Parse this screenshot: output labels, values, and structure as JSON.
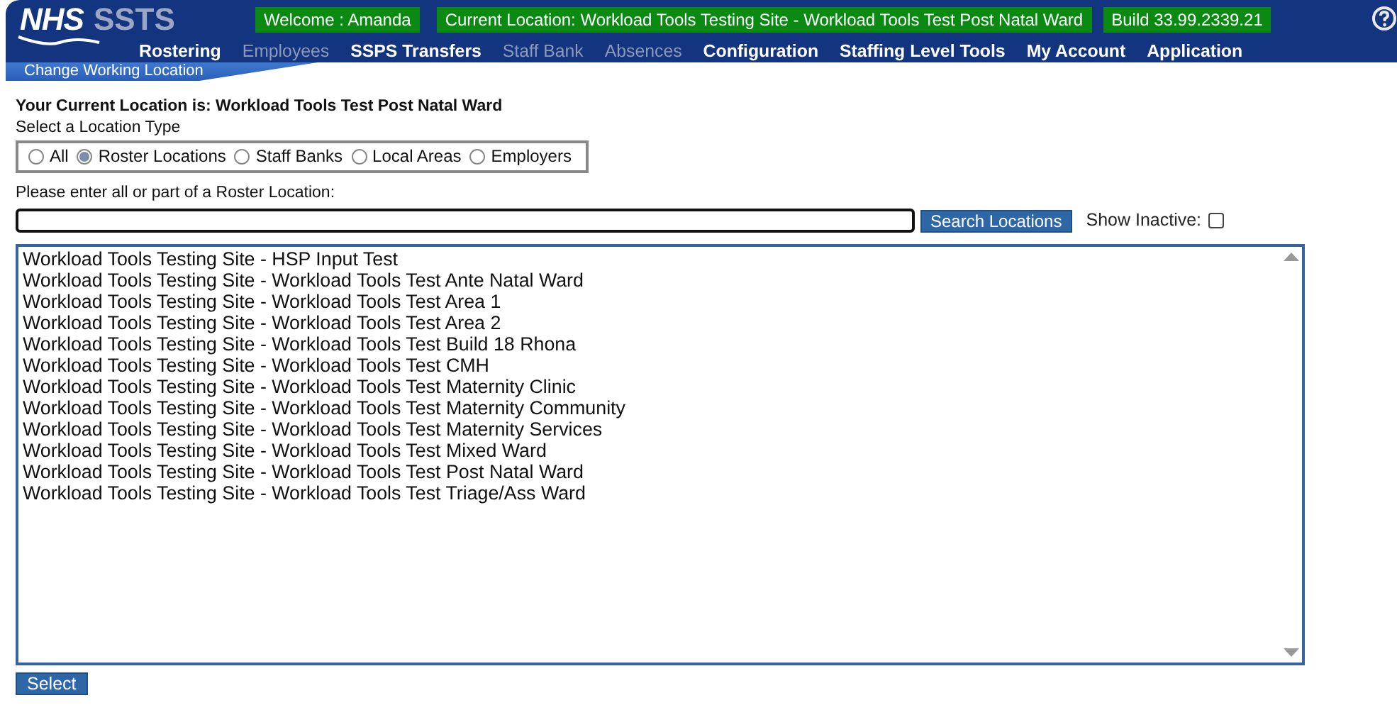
{
  "header": {
    "logo_primary": "NHS",
    "logo_secondary": "SSTS",
    "welcome": "Welcome : Amanda",
    "current_location": "Current Location: Workload Tools Testing Site - Workload Tools Test Post Natal Ward",
    "build": "Build 33.99.2339.21"
  },
  "menu": [
    {
      "label": "Rostering",
      "disabled": false
    },
    {
      "label": "Employees",
      "disabled": true
    },
    {
      "label": "SSPS Transfers",
      "disabled": false
    },
    {
      "label": "Staff Bank",
      "disabled": true
    },
    {
      "label": "Absences",
      "disabled": true
    },
    {
      "label": "Configuration",
      "disabled": false
    },
    {
      "label": "Staffing Level Tools",
      "disabled": false
    },
    {
      "label": "My Account",
      "disabled": false
    },
    {
      "label": "Application",
      "disabled": false
    }
  ],
  "breadcrumb": "Change Working Location",
  "current_location_heading": "Your Current Location is: Workload Tools Test Post Natal Ward",
  "location_type": {
    "label": "Select a Location Type",
    "options": [
      {
        "label": "All",
        "selected": false
      },
      {
        "label": "Roster Locations",
        "selected": true
      },
      {
        "label": "Staff Banks",
        "selected": false
      },
      {
        "label": "Local Areas",
        "selected": false
      },
      {
        "label": "Employers",
        "selected": false
      }
    ]
  },
  "search": {
    "label": "Please enter all or part of a Roster Location:",
    "button": "Search Locations",
    "show_inactive_label": "Show Inactive:",
    "show_inactive": false
  },
  "locations": [
    "Workload Tools Testing Site - HSP Input Test",
    "Workload Tools Testing Site - Workload Tools Test Ante Natal Ward",
    "Workload Tools Testing Site - Workload Tools Test Area 1",
    "Workload Tools Testing Site - Workload Tools Test Area 2",
    "Workload Tools Testing Site - Workload Tools Test Build 18 Rhona",
    "Workload Tools Testing Site - Workload Tools Test CMH",
    "Workload Tools Testing Site - Workload Tools Test Maternity Clinic",
    "Workload Tools Testing Site - Workload Tools Test Maternity Community",
    "Workload Tools Testing Site - Workload Tools Test Maternity Services",
    "Workload Tools Testing Site - Workload Tools Test Mixed Ward",
    "Workload Tools Testing Site - Workload Tools Test Post Natal Ward",
    "Workload Tools Testing Site - Workload Tools Test Triage/Ass Ward"
  ],
  "select_button": "Select"
}
